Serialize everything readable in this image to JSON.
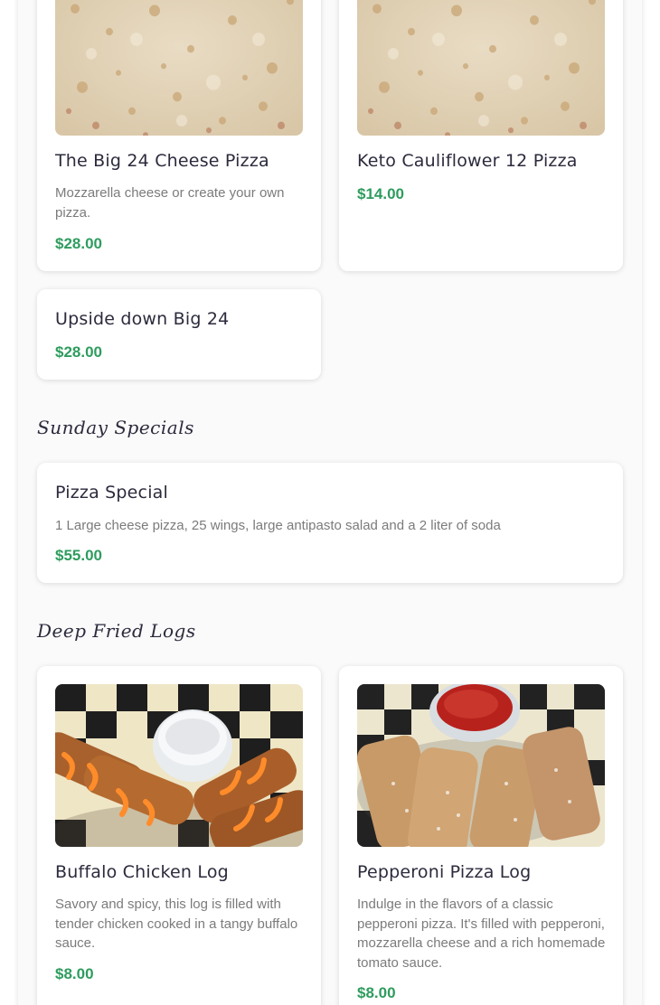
{
  "pizza_items": [
    {
      "name": "The Big 24 Cheese Pizza",
      "description": "Mozzarella cheese or create your own pizza.",
      "price": "$28.00",
      "image": "cheese-pizza-photo"
    },
    {
      "name": "Keto Cauliflower 12 Pizza",
      "description": "",
      "price": "$14.00",
      "image": "cheese-pizza-photo"
    },
    {
      "name": "Upside down Big 24",
      "description": "",
      "price": "$28.00"
    }
  ],
  "sunday_specials": {
    "title": "Sunday Specials",
    "items": [
      {
        "name": "Pizza Special",
        "description": "1 Large cheese pizza, 25 wings, large antipasto salad and a 2 liter of soda",
        "price": "$55.00"
      }
    ]
  },
  "deep_fried_logs": {
    "title": "Deep Fried Logs",
    "items": [
      {
        "name": "Buffalo Chicken Log",
        "description": "Savory and spicy, this log is filled with tender chicken cooked in a tangy buffalo sauce.",
        "price": "$8.00",
        "image": "buffalo-chicken-log-photo"
      },
      {
        "name": "Pepperoni Pizza Log",
        "description": "Indulge in the flavors of a classic pepperoni pizza. It's filled with pepperoni, mozzarella cheese and a rich homemade tomato sauce.",
        "price": "$8.00",
        "image": "pepperoni-pizza-log-photo"
      }
    ]
  },
  "colors": {
    "price": "#2e9c5e",
    "title": "#2b2b3d",
    "description": "#7b7b7b"
  }
}
